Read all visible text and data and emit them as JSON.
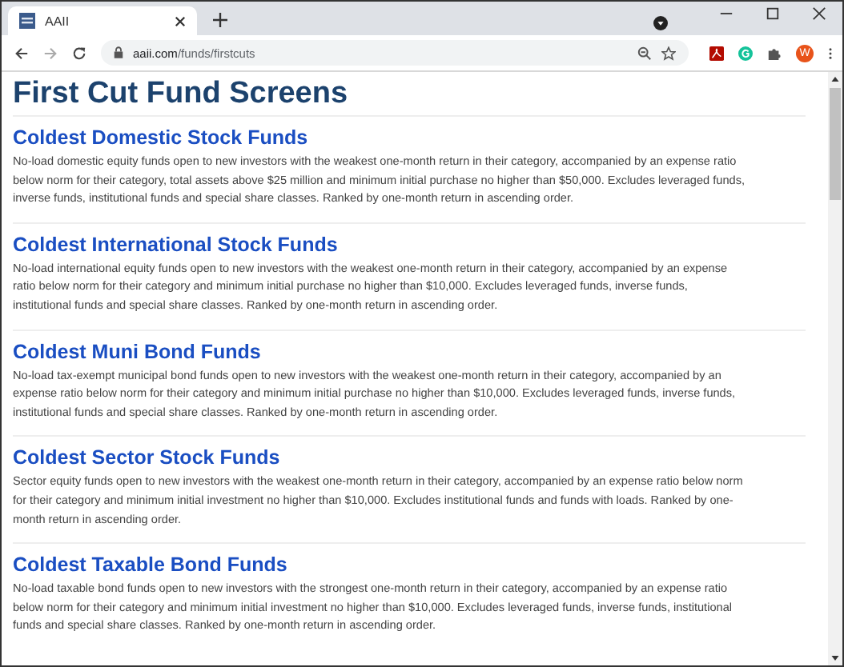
{
  "browser": {
    "tab": {
      "title": "AAII"
    },
    "address": {
      "host": "aaii.com",
      "path": "/funds/firstcuts"
    },
    "profile_initial": "W"
  },
  "page": {
    "title": "First Cut Fund Screens",
    "sections": [
      {
        "heading": "Coldest Domestic Stock Funds",
        "description": "No-load domestic equity funds open to new investors with the weakest one-month return in their category, accompanied by an expense ratio below norm for their category, total assets above $25 million and minimum initial purchase no higher than $50,000. Excludes leveraged funds, inverse funds, institutional funds and special share classes. Ranked by one-month return in ascending order."
      },
      {
        "heading": "Coldest International Stock Funds",
        "description": "No-load international equity funds open to new investors with the weakest one-month return in their category, accompanied by an expense ratio below norm for their category and minimum initial purchase no higher than $10,000. Excludes leveraged funds, inverse funds, institutional funds and special share classes. Ranked by one-month return in ascending order."
      },
      {
        "heading": "Coldest Muni Bond Funds",
        "description": "No-load tax-exempt municipal bond funds open to new investors with the weakest one-month return in their category, accompanied by an expense ratio below norm for their category and minimum initial purchase no higher than $10,000. Excludes leveraged funds, inverse funds, institutional funds and special share classes. Ranked by one-month return in ascending order."
      },
      {
        "heading": "Coldest Sector Stock Funds",
        "description": "Sector equity funds open to new investors with the weakest one-month return in their category, accompanied by an expense ratio below norm for their category and minimum initial investment no higher than $10,000. Excludes institutional funds and funds with loads. Ranked by one-month return in ascending order."
      },
      {
        "heading": "Coldest Taxable Bond Funds",
        "description": "No-load taxable bond funds open to new investors with the strongest one-month return in their category, accompanied by an expense ratio below norm for their category and minimum initial investment no higher than $10,000. Excludes leveraged funds, inverse funds, institutional funds and special share classes. Ranked by one-month return in ascending order."
      }
    ]
  }
}
